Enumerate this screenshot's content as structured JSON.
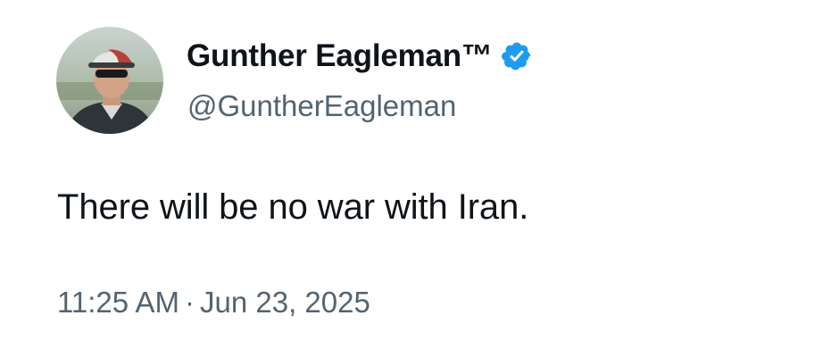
{
  "tweet": {
    "author": {
      "display_name": "Gunther Eagleman™",
      "handle": "@GuntherEagleman",
      "verified": true,
      "avatar_icon": "profile-photo"
    },
    "text": "There will be no war with Iran.",
    "time": "11:25 AM",
    "separator": "·",
    "date": "Jun 23, 2025"
  },
  "colors": {
    "text_primary": "#0f1419",
    "text_secondary": "#536471",
    "verified_blue": "#1d9bf0"
  }
}
